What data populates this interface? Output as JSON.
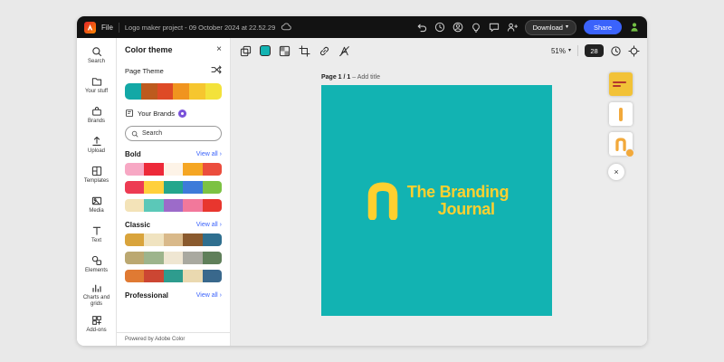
{
  "topbar": {
    "file": "File",
    "title": "Logo maker project - 09 October 2024 at 22.52.29",
    "download": "Download",
    "share": "Share",
    "share_color": "#3b63fb"
  },
  "rail": {
    "items": [
      {
        "label": "Search"
      },
      {
        "label": "Your stuff"
      },
      {
        "label": "Brands"
      },
      {
        "label": "Upload"
      },
      {
        "label": "Templates"
      },
      {
        "label": "Media"
      },
      {
        "label": "Text"
      },
      {
        "label": "Elements"
      },
      {
        "label": "Charts and grids"
      },
      {
        "label": "Add-ons"
      }
    ]
  },
  "panel": {
    "title": "Color theme",
    "page_theme": "Page Theme",
    "theme_colors": [
      "#13a8a6",
      "#bd5a1e",
      "#de4a26",
      "#f0941f",
      "#f6c62f",
      "#f3e23b"
    ],
    "your_brands": "Your Brands",
    "search_placeholder": "Search",
    "sections": [
      {
        "name": "Bold",
        "view_all": "View all",
        "palettes": [
          [
            "#f7a8c4",
            "#ed2939",
            "#fdf3e7",
            "#f5a623",
            "#eb4d3d"
          ],
          [
            "#ed3b53",
            "#ffd03b",
            "#23a68c",
            "#3d7bd9",
            "#7cc243"
          ],
          [
            "#f3e3b8",
            "#5bc8b8",
            "#9c6bc9",
            "#f2789b",
            "#e8362e"
          ]
        ]
      },
      {
        "name": "Classic",
        "view_all": "View all",
        "palettes": [
          [
            "#d9a43c",
            "#f0e3c0",
            "#d9b98a",
            "#8a5a2e",
            "#2f6f8f"
          ],
          [
            "#bba871",
            "#9db48c",
            "#efe6d2",
            "#a9a9a0",
            "#5f7f5a"
          ],
          [
            "#e07a33",
            "#cc4633",
            "#2e9c8e",
            "#ead9b0",
            "#39688c"
          ]
        ]
      },
      {
        "name": "Professional",
        "view_all": "View all",
        "palettes": []
      }
    ],
    "footer": "Powered by Adobe Color"
  },
  "canvas": {
    "zoom": "51%",
    "badge": "28",
    "page_label": "Page 1 / 1",
    "page_label_suffix": "– Add title",
    "background": "#12b3b2",
    "logo": {
      "line1": "The Branding",
      "line2": "Journal",
      "color": "#ffd02f"
    }
  },
  "thumbs": {
    "accent": "#f2a93b",
    "page_color": "#f2c237",
    "text_color": "#b3372c"
  }
}
